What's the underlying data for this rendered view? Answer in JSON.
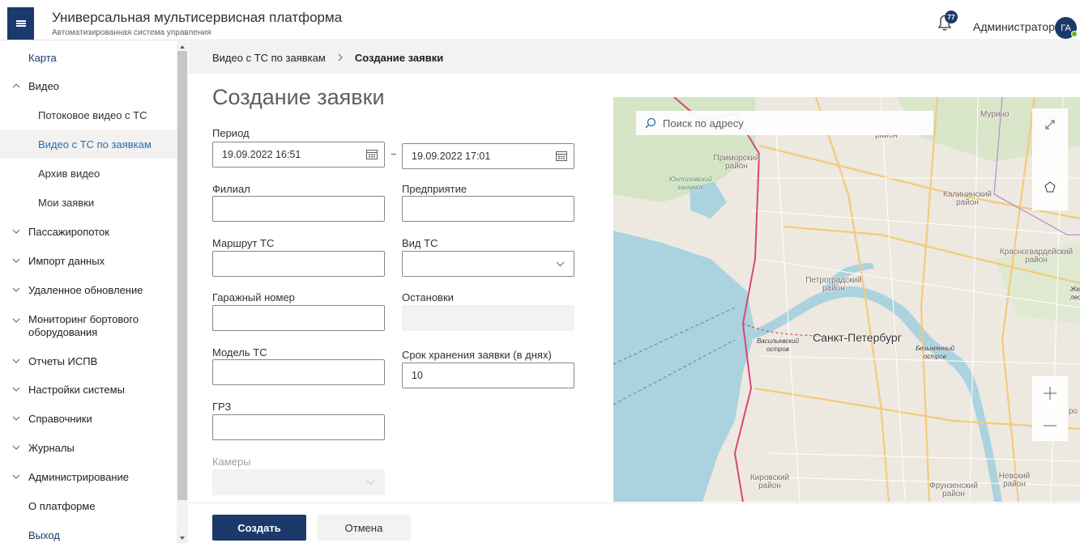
{
  "header": {
    "title": "Универсальная мультисервисная платформа",
    "subtitle": "Автоматизированная система управления",
    "notification_count": "77",
    "user_name": "Администратор",
    "user_initials": "ГА"
  },
  "sidebar": {
    "items": [
      {
        "label": "Карта"
      },
      {
        "label": "Видео"
      },
      {
        "label": "Потоковое видео с ТС"
      },
      {
        "label": "Видео с ТС по заявкам"
      },
      {
        "label": "Архив видео"
      },
      {
        "label": "Мои заявки"
      },
      {
        "label": "Пассажиропоток"
      },
      {
        "label": "Импорт данных"
      },
      {
        "label": "Удаленное обновление"
      },
      {
        "label": "Мониторинг бортового оборудования"
      },
      {
        "label": "Отчеты ИСПВ"
      },
      {
        "label": "Настройки системы"
      },
      {
        "label": "Справочники"
      },
      {
        "label": "Журналы"
      },
      {
        "label": "Администрирование"
      },
      {
        "label": "О платформе"
      },
      {
        "label": "Выход"
      }
    ]
  },
  "breadcrumb": {
    "parent": "Видео с ТС по заявкам",
    "current": "Создание заявки"
  },
  "form": {
    "title": "Создание заявки",
    "period_label": "Период",
    "period_start": "19.09.2022 16:51",
    "period_end": "19.09.2022 17:01",
    "branch_label": "Филиал",
    "enterprise_label": "Предприятие",
    "route_label": "Маршрут ТС",
    "vehicle_type_label": "Вид ТС",
    "garage_label": "Гаражный номер",
    "stops_label": "Остановки",
    "model_label": "Модель ТС",
    "storage_label": "Срок хранения заявки (в днях)",
    "storage_value": "10",
    "plate_label": "ГРЗ",
    "cameras_label": "Камеры",
    "create_button": "Создать",
    "cancel_button": "Отмена"
  },
  "map": {
    "search_placeholder": "Поиск по адресу",
    "labels": {
      "murino": "Мурино",
      "primorsky": "Приморский район",
      "yuntolovsky": "Юнтоловский заказник",
      "kalininsky": "Калининский район",
      "krasnogvardeysky": "Красногвардейский район",
      "petrogradsky": "Петроградский район",
      "vasilyevsky": "Васильевский остров",
      "spb": "Санкт-Петербург",
      "bezymyanny": "Безымянный остров",
      "kirovsky": "Кировский район",
      "frunzensky": "Фрунзенский район",
      "nevsky": "Невский район",
      "rayon_top": "район",
      "zhelez": "Жележ",
      "leono": "леоно",
      "pro": "ро"
    },
    "colors": {
      "water": "#aad3df",
      "land": "#ede9e0",
      "park": "#c8e0b8",
      "border": "#d8457a",
      "major_road": "#f5c97a"
    }
  }
}
